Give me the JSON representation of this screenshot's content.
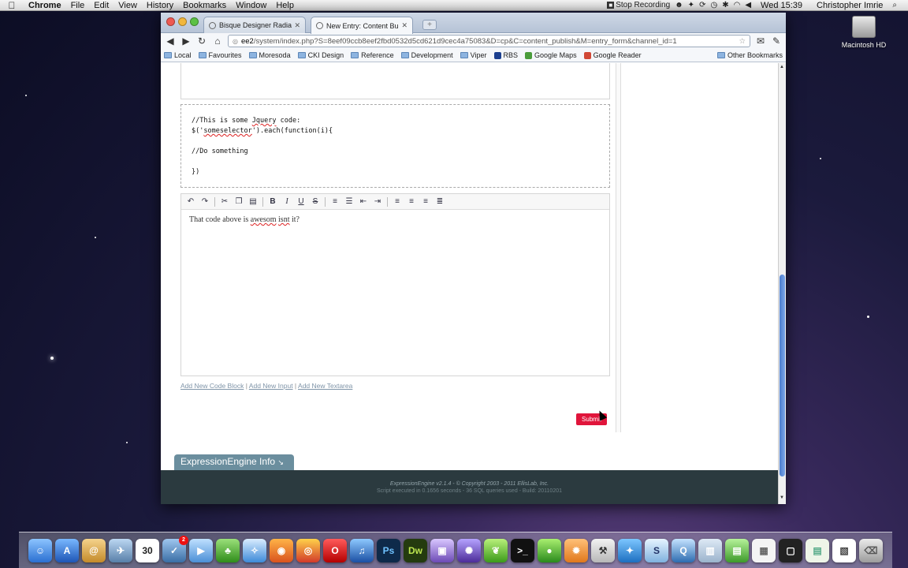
{
  "menubar": {
    "app": "Chrome",
    "items": [
      "File",
      "Edit",
      "View",
      "History",
      "Bookmarks",
      "Window",
      "Help"
    ],
    "recording": "Stop Recording",
    "clock": "Wed 15:39",
    "user": "Christopher Imrie"
  },
  "desktop": {
    "disk_label": "Macintosh HD"
  },
  "browser": {
    "tabs": [
      {
        "label": "Bisque Designer Radiators"
      },
      {
        "label": "New Entry: Content Builder"
      }
    ],
    "url_host": "ee2",
    "url_path": "/system/index.php?S=8eef09ccb8eef2fbd0532d5cd621d9cec4a75083&D=cp&C=content_publish&M=entry_form&channel_id=1",
    "bookmarks": [
      "Local",
      "Favourites",
      "Moresoda",
      "CKI Design",
      "Reference",
      "Development",
      "Viper",
      "RBS",
      "Google Maps",
      "Google Reader"
    ],
    "other_bookmarks": "Other Bookmarks"
  },
  "content": {
    "code_lines": [
      "//This is some Jquery code:",
      "$('someselector').each(function(i){",
      "",
      "//Do something",
      "",
      "})"
    ],
    "editor_text": "That code above is awesom isnt it?",
    "add_links": [
      "Add New Code Block",
      "Add New Input",
      "Add New Textarea"
    ],
    "submit_label": "Submit",
    "ee_info": "ExpressionEngine Info",
    "footer_line1": "ExpressionEngine v2.1.4 - © Copyright 2003 - 2011 EllisLab, Inc.",
    "footer_line2": "Script executed in 0.1656 seconds - 36 SQL queries used - Build:  20110201"
  },
  "dock": {
    "calendar_day": "30",
    "notification_badge": "2"
  },
  "colors": {
    "submit": "#e0153b",
    "footer": "#2b3a3f",
    "ee_tab": "#6b8e9e",
    "scroll_thumb": "#4b7ccd"
  }
}
